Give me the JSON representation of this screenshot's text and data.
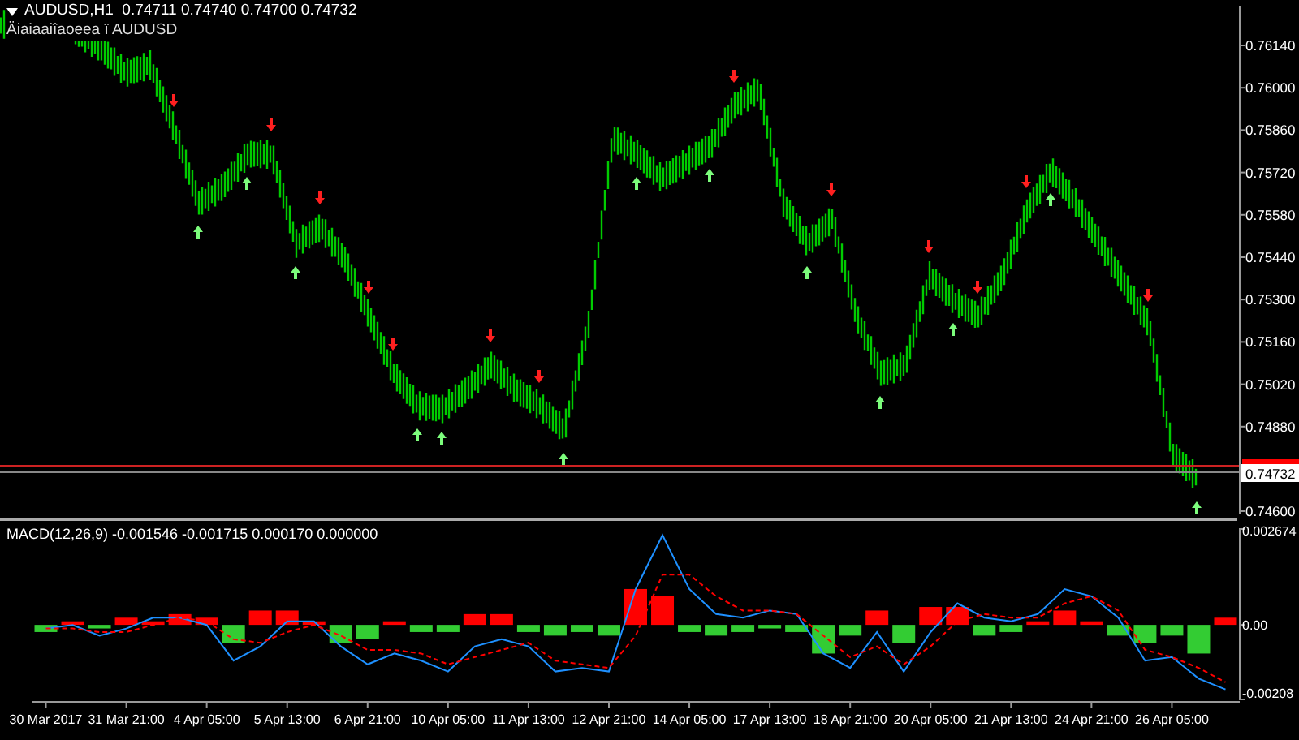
{
  "header": {
    "symbol_line": "AUDUSD,H1  0.74711 0.74740 0.74700 0.74732",
    "indicator_line": "Äiaiaaiîaoeea ï AUDUSD"
  },
  "price_axis": {
    "labels": [
      "0.76140",
      "0.76000",
      "0.75860",
      "0.75720",
      "0.75580",
      "0.75440",
      "0.75300",
      "0.75160",
      "0.75020",
      "0.74880",
      "0.74600"
    ],
    "current_price": "0.74732"
  },
  "macd_panel": {
    "label": "MACD(12,26,9) -0.001546 -0.001715 0.000170 0.000000",
    "chart_data": {
      "type": "bar",
      "categories": [
        "30 Mar 2017",
        null,
        null,
        "31 Mar 21:00",
        null,
        null,
        "4 Apr 05:00",
        null,
        null,
        "5 Apr 13:00",
        null,
        null,
        "6 Apr 21:00",
        null,
        null,
        "10 Apr 05:00",
        null,
        null,
        "11 Apr 13:00",
        null,
        null,
        "12 Apr 21:00",
        null,
        null,
        "14 Apr 05:00",
        null,
        null,
        "17 Apr 13:00",
        null,
        null,
        "18 Apr 21:00",
        null,
        null,
        "20 Apr 05:00",
        null,
        null,
        "21 Apr 13:00",
        null,
        null,
        "24 Apr 21:00",
        null,
        null,
        "26 Apr 05:00",
        null,
        null
      ],
      "series": [
        {
          "color": "#ff0000",
          "values": [
            null,
            0.0001,
            null,
            0.0002,
            0.0001,
            0.0003,
            0.0002,
            null,
            0.0004,
            0.0004,
            0.0001,
            null,
            null,
            0.0001,
            null,
            null,
            0.0003,
            0.0003,
            null,
            null,
            null,
            null,
            0.001,
            0.0008,
            null,
            null,
            null,
            null,
            null,
            null,
            null,
            0.0004,
            null,
            0.0005,
            0.0005,
            null,
            null,
            0.0001,
            0.0004,
            0.0001,
            null,
            null,
            null,
            null,
            0.0002
          ]
        },
        {
          "color": "#33cc33",
          "values": [
            -0.0002,
            null,
            -0.0001,
            null,
            null,
            null,
            null,
            -0.0005,
            null,
            null,
            null,
            -0.0005,
            -0.0004,
            null,
            -0.0002,
            -0.0002,
            null,
            null,
            -0.0002,
            -0.0003,
            -0.0002,
            -0.0003,
            null,
            null,
            -0.0002,
            -0.0003,
            -0.0002,
            -0.0001,
            -0.0002,
            -0.0008,
            -0.0003,
            null,
            -0.0005,
            null,
            null,
            -0.0003,
            -0.0002,
            null,
            null,
            null,
            -0.0003,
            -0.0005,
            -0.0003,
            -0.0008,
            null
          ]
        },
        {
          "type": "line",
          "color": "#1e90ff",
          "values": [
            -0.0001,
            0.0,
            -0.0003,
            -0.0001,
            0.0002,
            0.0002,
            0.0,
            -0.001,
            -0.0006,
            0.0001,
            0.0001,
            -0.0006,
            -0.0011,
            -0.0008,
            -0.001,
            -0.0013,
            -0.0006,
            -0.0004,
            -0.0006,
            -0.0013,
            -0.0012,
            -0.0013,
            0.001,
            0.0025,
            0.001,
            0.0003,
            0.0002,
            0.0004,
            0.0003,
            -0.0008,
            -0.0012,
            -0.0002,
            -0.0013,
            -0.0002,
            0.0006,
            0.0002,
            0.0001,
            0.0003,
            0.001,
            0.0008,
            0.0002,
            -0.001,
            -0.0009,
            -0.0015,
            -0.0018
          ]
        },
        {
          "type": "line",
          "line_style": "dashed",
          "color": "#ff0000",
          "values": [
            -0.0001,
            -0.0001,
            -0.0002,
            -0.0002,
            0.0,
            0.0002,
            0.0001,
            -0.0004,
            -0.0005,
            -0.0002,
            0.0,
            -0.0003,
            -0.0007,
            -0.0007,
            -0.0008,
            -0.0011,
            -0.0009,
            -0.0007,
            -0.0005,
            -0.001,
            -0.0011,
            -0.0012,
            -0.0003,
            0.0014,
            0.0014,
            0.0008,
            0.0004,
            0.0004,
            0.0003,
            -0.0003,
            -0.0009,
            -0.0006,
            -0.0011,
            -0.0006,
            0.0001,
            0.0003,
            0.0002,
            0.0002,
            0.0006,
            0.0008,
            0.0004,
            -0.0007,
            -0.0009,
            -0.0012,
            -0.0016
          ]
        }
      ],
      "ylim": [
        -0.00208,
        0.002674
      ],
      "yticks": [
        0.002674,
        {
          "value": 0,
          "label": "0.00"
        },
        -0.00208
      ]
    }
  }
}
